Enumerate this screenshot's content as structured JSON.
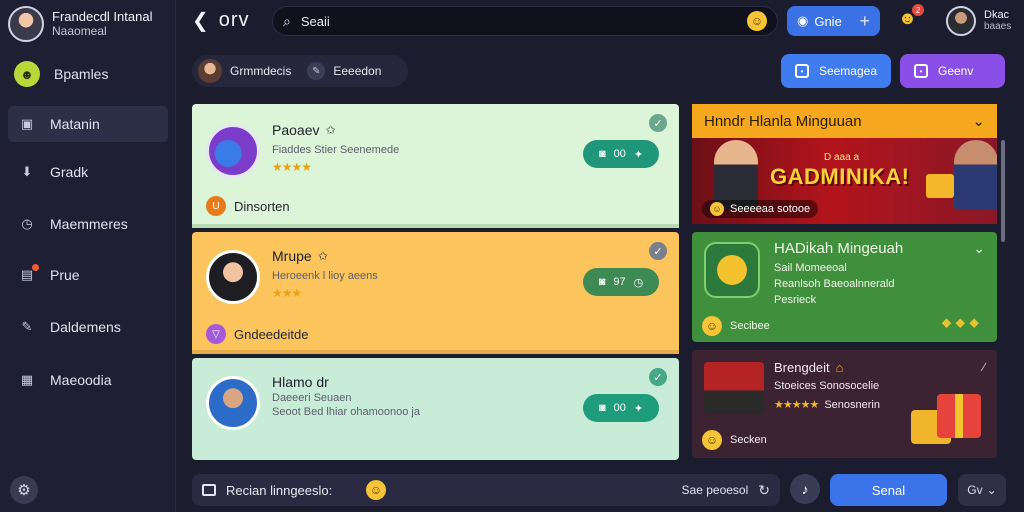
{
  "profile": {
    "name": "Frandecdl Intanal",
    "handle": "Naaomeal"
  },
  "sidebar": {
    "items": [
      {
        "label": "Bpamles",
        "icon": "green-badge-icon"
      },
      {
        "label": "Matanin",
        "icon": "folder-icon"
      },
      {
        "label": "Gradk",
        "icon": "download-icon"
      },
      {
        "label": "Maemmeres",
        "icon": "clock-icon"
      },
      {
        "label": "Prue",
        "icon": "bell-icon"
      },
      {
        "label": "Daldemens",
        "icon": "edit-icon"
      },
      {
        "label": "Maeoodia",
        "icon": "camera-icon"
      }
    ]
  },
  "topbar": {
    "logo": "orv",
    "search_value": "Seaii",
    "new_button": "Gnie",
    "notif_count": "2",
    "user_name": "Dkac",
    "user_sub": "baaes"
  },
  "filters": {
    "chip1": "Grmmdecis",
    "chip2": "Eeeedon"
  },
  "actions": {
    "primary": "Seemagea",
    "secondary": "Geenv"
  },
  "list": [
    {
      "title": "Paoaev",
      "subtitle": "Fiaddes Stier Seenemede",
      "stars": "★★★★",
      "pill": "00",
      "footer": "Dinsorten"
    },
    {
      "title": "Mrupe",
      "subtitle": "Heroeenk l lioy aeens",
      "stars": "★★★",
      "pill": "97",
      "footer": "Gndeedeitde"
    },
    {
      "title": "Hlamo dr",
      "subtitle": "Daeeeri Seuaen",
      "subtitle2": "Seoot Bed lhiar ohamoonoo ja",
      "pill": "00"
    }
  ],
  "right_panel": {
    "header": "Hnndr Hlanla Minguuan",
    "banner_title": "GADMINIKA!",
    "banner_top": "D aaa a",
    "banner_caption": "Seeeeaa sotooe",
    "card1": {
      "title": "HADikah Mingeuah",
      "line1": "Sail Momeeoal",
      "line2": "Reanlsoh Baeoalnnerald",
      "line3": "Pesrieck",
      "footer": "Secibee"
    },
    "card2": {
      "title": "Brengdeit",
      "line1": "Stoeices Sonosocelie",
      "rating_label": "Senosnerin",
      "stars": "★★★★★",
      "footer": "Secken"
    }
  },
  "composer": {
    "placeholder": "Recian linngeeslo:",
    "right_text": "Sae peoesol",
    "send_label": "Senal",
    "more_label": "Gv"
  },
  "colors": {
    "accent_blue": "#3b74ea",
    "accent_purple": "#8a4fe6",
    "card_green": "#dcf5d8",
    "card_orange": "#fbc45c",
    "card_mint": "#c9ecd8"
  }
}
